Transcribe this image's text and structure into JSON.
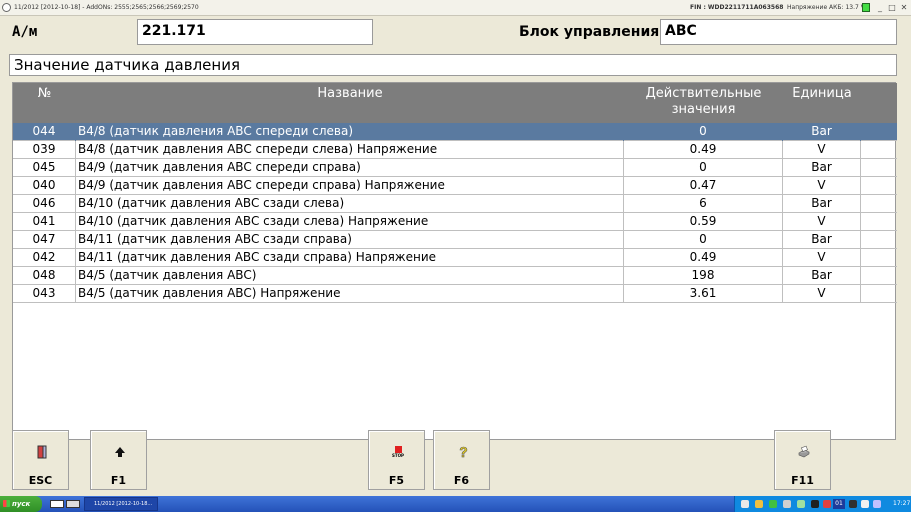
{
  "titlebar": {
    "title": "11/2012 [2012-10-18] - AddONs: 2555;2565;2566;2569;2570",
    "fin": "FIN : WDD2211711A063568",
    "battery": "Напряжение АКБ: 13.7 V",
    "min": "_",
    "max": "□",
    "close": "✕"
  },
  "header": {
    "am_label": "A/м",
    "am_value": "221.171",
    "block_label": "Блок управления",
    "block_value": "ABC",
    "section_title": "Значение датчика давления"
  },
  "table": {
    "headers": {
      "num": "№",
      "name": "Название",
      "value1": "Действительные",
      "value2": "значения",
      "unit": "Единица"
    },
    "rows": [
      {
        "num": "044",
        "name": "B4/8 (датчик давления ABC спереди слева)",
        "value": "0",
        "unit": "Bar"
      },
      {
        "num": "039",
        "name": "B4/8 (датчик давления ABC спереди слева) Напряжение",
        "value": "0.49",
        "unit": "V"
      },
      {
        "num": "045",
        "name": "B4/9 (датчик давления ABC спереди справа)",
        "value": "0",
        "unit": "Bar"
      },
      {
        "num": "040",
        "name": "B4/9 (датчик давления ABC спереди справа) Напряжение",
        "value": "0.47",
        "unit": "V"
      },
      {
        "num": "046",
        "name": "B4/10 (датчик давления ABC сзади слева)",
        "value": "6",
        "unit": "Bar"
      },
      {
        "num": "041",
        "name": "B4/10 (датчик давления ABC сзади слева) Напряжение",
        "value": "0.59",
        "unit": "V"
      },
      {
        "num": "047",
        "name": "B4/11 (датчик давления ABC сзади справа)",
        "value": "0",
        "unit": "Bar"
      },
      {
        "num": "042",
        "name": "B4/11 (датчик давления ABC сзади справа) Напряжение",
        "value": "0.49",
        "unit": "V"
      },
      {
        "num": "048",
        "name": "B4/5 (датчик давления ABC)",
        "value": "198",
        "unit": "Bar"
      },
      {
        "num": "043",
        "name": "B4/5 (датчик давления ABC) Напряжение",
        "value": "3.61",
        "unit": "V"
      }
    ]
  },
  "buttons": {
    "esc": "ESC",
    "f1": "F1",
    "f5": "F5",
    "f5_icon_text": "STOP",
    "f6": "F6",
    "f11": "F11"
  },
  "taskbar": {
    "start": "пуск",
    "task": "11/2012 [2012-10-18...",
    "lang": "01",
    "clock": "17:27"
  }
}
